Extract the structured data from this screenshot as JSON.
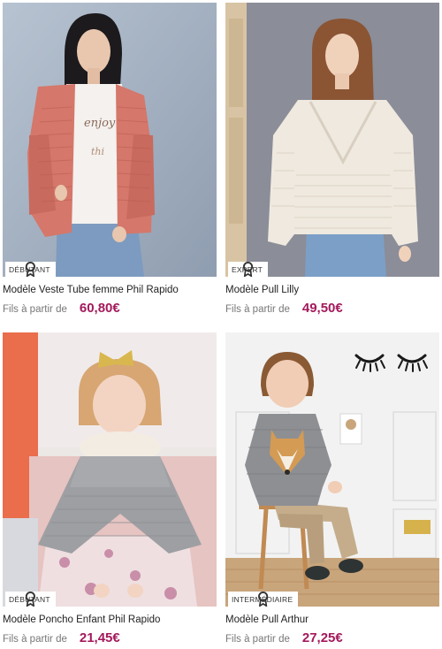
{
  "products": [
    {
      "level": "DÉBUTANT",
      "title": "Modèle Veste Tube femme Phil Rapido",
      "from_label": "Fils à partir de",
      "price": "60,80€",
      "image": "woman-pink-knit-cardigan-photo"
    },
    {
      "level": "EXPERT",
      "title": "Modèle Pull Lilly",
      "from_label": "Fils à partir de",
      "price": "49,50€",
      "image": "woman-cream-knit-sweater-photo"
    },
    {
      "level": "DÉBUTANT",
      "title": "Modèle Poncho Enfant Phil Rapido",
      "from_label": "Fils à partir de",
      "price": "21,45€",
      "image": "girl-grey-knit-poncho-photo"
    },
    {
      "level": "INTERMÉDIAIRE",
      "title": "Modèle Pull Arthur",
      "from_label": "Fils à partir de",
      "price": "27,25€",
      "image": "boy-fox-knit-sweater-photo"
    }
  ],
  "colors": {
    "price": "#a3195b",
    "title": "#222222",
    "muted": "#777777",
    "badge_bg": "#ffffff"
  }
}
